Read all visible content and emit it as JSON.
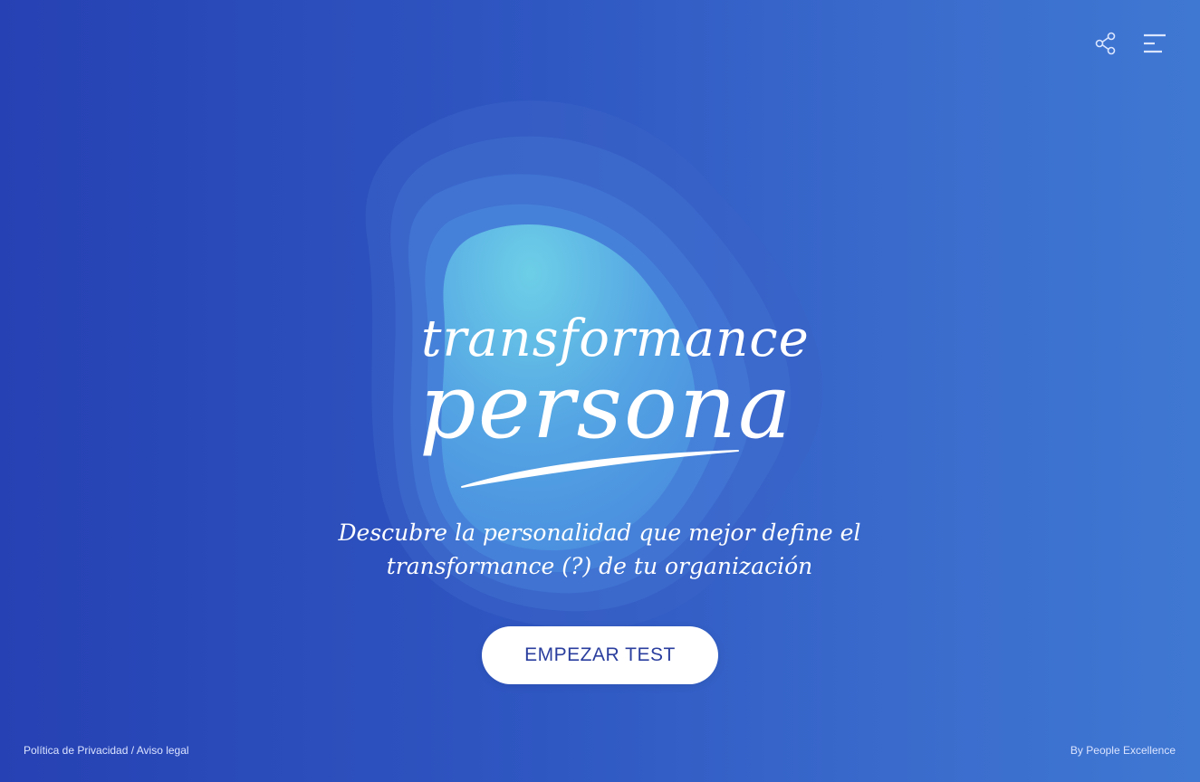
{
  "header": {
    "share_icon": "share-icon",
    "menu_icon": "menu-icon"
  },
  "logo": {
    "line1": "transformance",
    "line2": "persona"
  },
  "tagline": {
    "line1": "Descubre la personalidad que mejor define el",
    "line2": "transformance (?) de tu organización"
  },
  "cta": {
    "label": "EMPEZAR TEST"
  },
  "footer": {
    "privacy_label": "Política de Privacidad",
    "separator": " / ",
    "legal_label": "Aviso legal",
    "credit": "By People Excellence"
  },
  "colors": {
    "background_start": "#2641b3",
    "background_end": "#3f78d3",
    "button_bg": "#ffffff",
    "button_text": "#2a3e9e",
    "blob_core": "#6fd3e8"
  }
}
